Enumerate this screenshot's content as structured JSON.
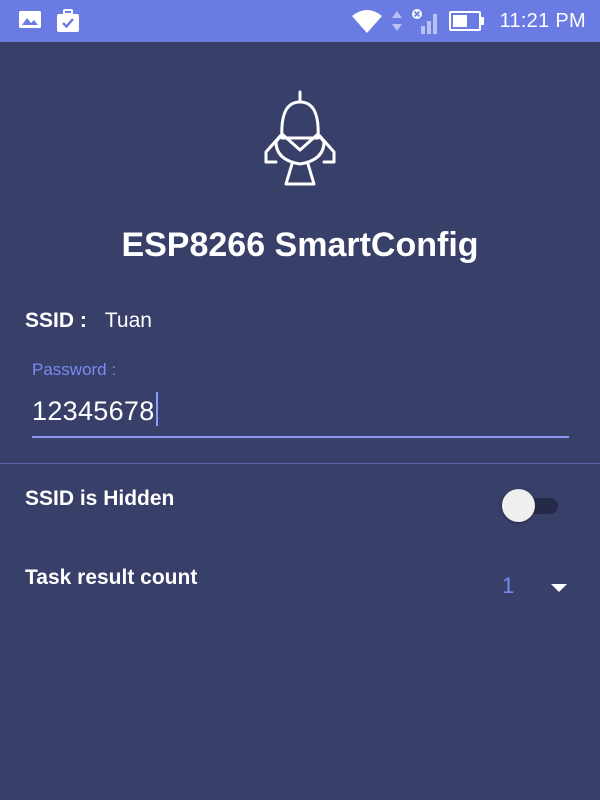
{
  "status_bar": {
    "time": "11:21 PM",
    "left_icons": [
      "gallery-icon",
      "briefcase-check-icon"
    ],
    "right_icons": [
      "wifi-icon",
      "data-arrows-icon",
      "no-signal-icon",
      "battery-icon"
    ],
    "color": "#6a7be4"
  },
  "app": {
    "logo_icon": "smartconfig-logo-icon",
    "title": "ESP8266 SmartConfig"
  },
  "ssid": {
    "label": "SSID :",
    "value": "Tuan"
  },
  "password": {
    "label": "Password :",
    "value": "12345678"
  },
  "hidden": {
    "label": "SSID is Hidden",
    "checked": false
  },
  "task_count": {
    "label": "Task result count",
    "selected": "1"
  },
  "colors": {
    "background": "#383f69",
    "accent": "#7a8af0",
    "text": "#ffffff"
  }
}
